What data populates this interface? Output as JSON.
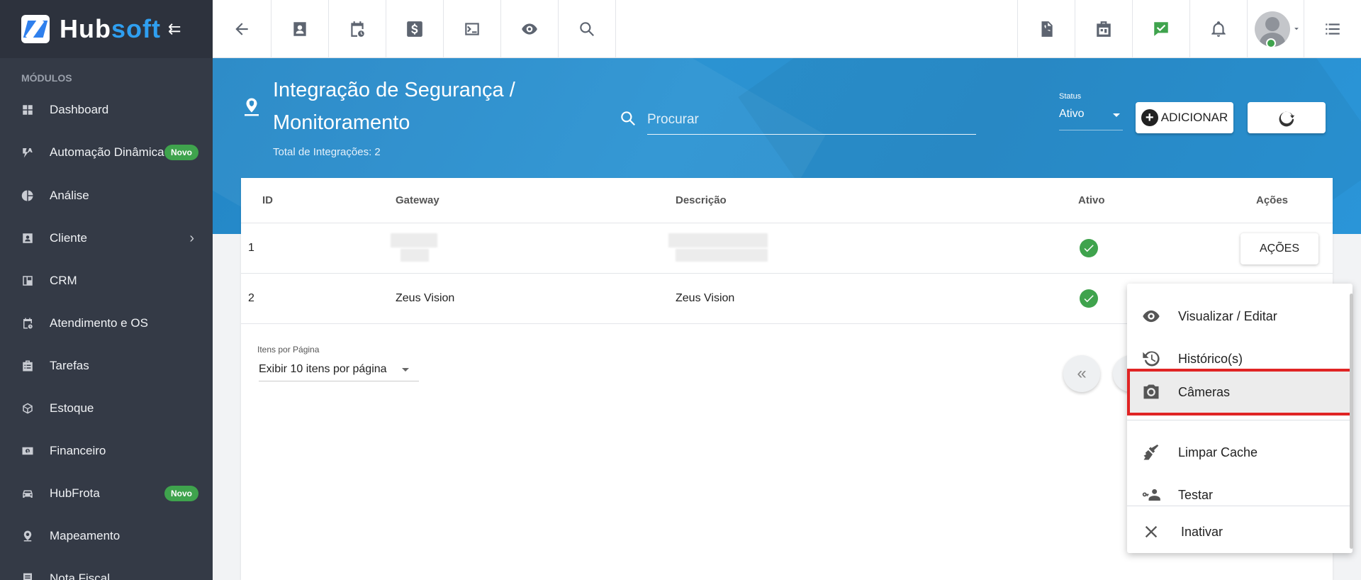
{
  "brand": {
    "part1": "Hub",
    "part2": "soft",
    "collapse_symbol": "⇇"
  },
  "sidebar": {
    "section_title": "MÓDULOS",
    "items": [
      {
        "label": "Dashboard",
        "icon": "dashboard-icon"
      },
      {
        "label": "Automação Dinâmica",
        "icon": "automation-icon",
        "badge": "Novo"
      },
      {
        "label": "Análise",
        "icon": "pie-chart-icon"
      },
      {
        "label": "Cliente",
        "icon": "client-card-icon",
        "chevron": "›"
      },
      {
        "label": "CRM",
        "icon": "crm-board-icon"
      },
      {
        "label": "Atendimento e OS",
        "icon": "calendar-clock-icon"
      },
      {
        "label": "Tarefas",
        "icon": "tasks-icon"
      },
      {
        "label": "Estoque",
        "icon": "box-icon"
      },
      {
        "label": "Financeiro",
        "icon": "money-icon"
      },
      {
        "label": "HubFrota",
        "icon": "car-icon",
        "badge": "Novo"
      },
      {
        "label": "Mapeamento",
        "icon": "map-pin-icon"
      },
      {
        "label": "Nota Fiscal",
        "icon": "invoice-icon"
      }
    ]
  },
  "page": {
    "title": "Integração de Segurança / Monitoramento",
    "subtitle": "Total de Integrações: 2",
    "search_placeholder": "Procurar",
    "status_label": "Status",
    "status_value": "Ativo",
    "add_label": "ADICIONAR",
    "add_plus": "+"
  },
  "table": {
    "headers": {
      "id": "ID",
      "gateway": "Gateway",
      "descricao": "Descrição",
      "ativo": "Ativo",
      "acoes": "Ações"
    },
    "rows": [
      {
        "id": "1",
        "gateway": "",
        "descricao": "",
        "ativo": true,
        "acoes_label": "AÇÕES"
      },
      {
        "id": "2",
        "gateway": "Zeus Vision",
        "descricao": "Zeus Vision",
        "ativo": true
      }
    ]
  },
  "pagination": {
    "per_page_label": "Itens por Página",
    "per_page_value": "Exibir 10 itens por página",
    "first_symbol": "«"
  },
  "actions_menu": {
    "items": [
      {
        "label": "Visualizar / Editar",
        "icon": "eye-icon"
      },
      {
        "label": "Histórico(s)",
        "icon": "history-icon"
      },
      {
        "label": "Câmeras",
        "icon": "camera-icon",
        "highlighted": true
      },
      {
        "label": "Limpar Cache",
        "icon": "broom-icon"
      },
      {
        "label": "Testar",
        "icon": "person-key-icon"
      },
      {
        "label": "Inativar",
        "icon": "close-icon"
      }
    ]
  },
  "colors": {
    "banner": "#2a8ecd",
    "sidebar": "#343a46",
    "success": "#3fa34d",
    "highlight_border": "#e02424",
    "brand_accent": "#2f9ff0"
  }
}
